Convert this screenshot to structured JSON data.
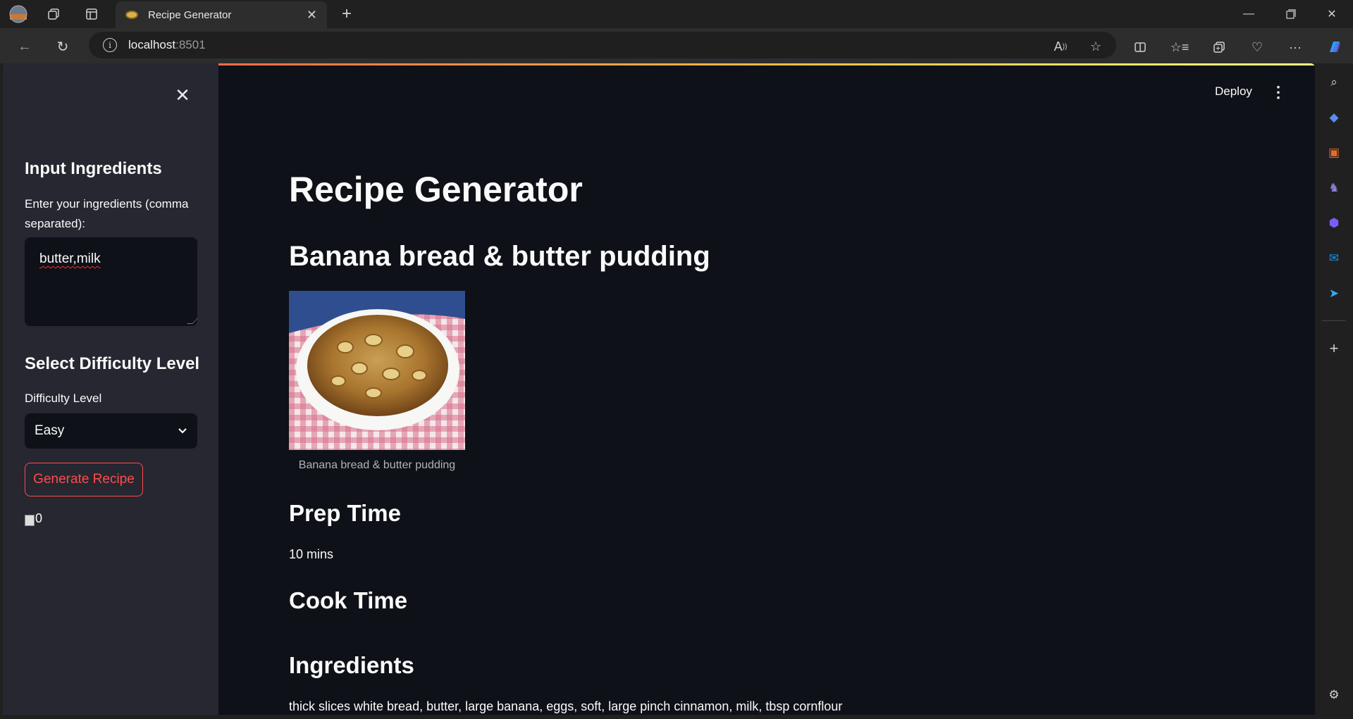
{
  "browser": {
    "tab_title": "Recipe Generator",
    "url_host": "localhost",
    "url_port": ":8501"
  },
  "app": {
    "deploy_label": "Deploy",
    "title": "Recipe Generator"
  },
  "sidebar": {
    "ingredients_heading": "Input Ingredients",
    "ingredients_label": "Enter your ingredients (comma separated):",
    "ingredients_value": "butter,milk",
    "difficulty_heading": "Select Difficulty Level",
    "difficulty_label": "Difficulty Level",
    "difficulty_value": "Easy",
    "generate_button": "Generate Recipe",
    "broken_image_alt": "0"
  },
  "recipe": {
    "name": "Banana bread & butter pudding",
    "image_caption": "Banana bread & butter pudding",
    "prep_time_heading": "Prep Time",
    "prep_time_value": "10 mins",
    "cook_time_heading": "Cook Time",
    "ingredients_heading": "Ingredients",
    "ingredients_value": "thick slices white bread, butter, large banana, eggs, soft, large pinch cinnamon, milk, tbsp cornflour"
  },
  "colors": {
    "accent": "#ff4b4b",
    "background": "#0e1117",
    "sidebar_bg": "#262730"
  }
}
